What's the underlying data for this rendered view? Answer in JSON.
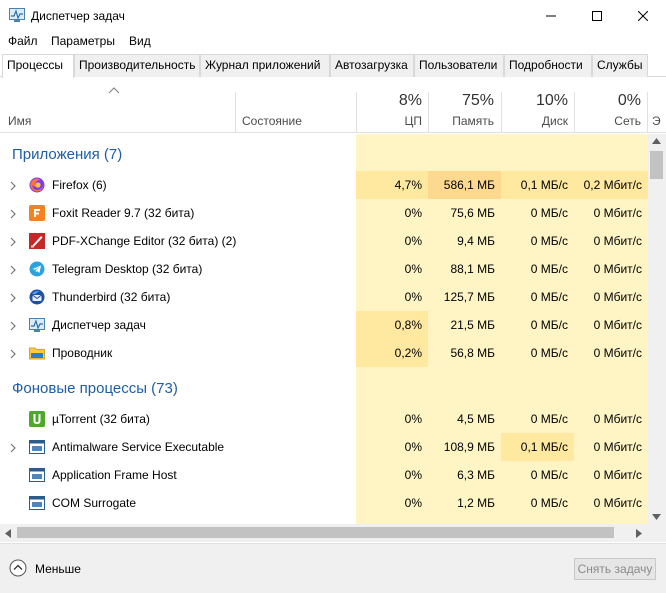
{
  "window": {
    "title": "Диспетчер задач"
  },
  "menu": [
    {
      "label": "Файл"
    },
    {
      "label": "Параметры"
    },
    {
      "label": "Вид"
    }
  ],
  "tabs": [
    {
      "label": "Процессы",
      "active": true
    },
    {
      "label": "Производительность"
    },
    {
      "label": "Журнал приложений"
    },
    {
      "label": "Автозагрузка"
    },
    {
      "label": "Пользователи"
    },
    {
      "label": "Подробности"
    },
    {
      "label": "Службы"
    }
  ],
  "columns": {
    "name": "Имя",
    "status": "Состояние",
    "cpu": {
      "pct": "8%",
      "label": "ЦП"
    },
    "memory": {
      "pct": "75%",
      "label": "Память"
    },
    "disk": {
      "pct": "10%",
      "label": "Диск"
    },
    "network": {
      "pct": "0%",
      "label": "Сеть"
    },
    "overflow": "Э"
  },
  "groups": {
    "apps": "Приложения (7)",
    "background": "Фоновые процессы (73)"
  },
  "apps": [
    {
      "name": "Firefox (6)",
      "icon": "firefox-icon",
      "expand": true,
      "cpu": "4,7%",
      "mem": "586,1 МБ",
      "disk": "0,1 МБ/с",
      "net": "0,2 Мбит/с"
    },
    {
      "name": "Foxit Reader 9.7 (32 бита)",
      "icon": "foxit-icon",
      "expand": true,
      "cpu": "0%",
      "mem": "75,6 МБ",
      "disk": "0 МБ/с",
      "net": "0 Мбит/с"
    },
    {
      "name": "PDF-XChange Editor (32 бита) (2)",
      "icon": "pdf-xchange-icon",
      "expand": true,
      "cpu": "0%",
      "mem": "9,4 МБ",
      "disk": "0 МБ/с",
      "net": "0 Мбит/с"
    },
    {
      "name": "Telegram Desktop (32 бита)",
      "icon": "telegram-icon",
      "expand": true,
      "cpu": "0%",
      "mem": "88,1 МБ",
      "disk": "0 МБ/с",
      "net": "0 Мбит/с"
    },
    {
      "name": "Thunderbird (32 бита)",
      "icon": "thunderbird-icon",
      "expand": true,
      "cpu": "0%",
      "mem": "125,7 МБ",
      "disk": "0 МБ/с",
      "net": "0 Мбит/с"
    },
    {
      "name": "Диспетчер задач",
      "icon": "task-manager-icon",
      "expand": true,
      "cpu": "0,8%",
      "mem": "21,5 МБ",
      "disk": "0 МБ/с",
      "net": "0 Мбит/с"
    },
    {
      "name": "Проводник",
      "icon": "explorer-icon",
      "expand": true,
      "cpu": "0,2%",
      "mem": "56,8 МБ",
      "disk": "0 МБ/с",
      "net": "0 Мбит/с"
    }
  ],
  "background": [
    {
      "name": "µTorrent (32 бита)",
      "icon": "utorrent-icon",
      "expand": false,
      "cpu": "0%",
      "mem": "4,5 МБ",
      "disk": "0 МБ/с",
      "net": "0 Мбит/с"
    },
    {
      "name": "Antimalware Service Executable",
      "icon": "service-icon",
      "expand": true,
      "cpu": "0%",
      "mem": "108,9 МБ",
      "disk": "0,1 МБ/с",
      "net": "0 Мбит/с"
    },
    {
      "name": "Application Frame Host",
      "icon": "service-icon",
      "expand": false,
      "cpu": "0%",
      "mem": "6,3 МБ",
      "disk": "0 МБ/с",
      "net": "0 Мбит/с"
    },
    {
      "name": "COM Surrogate",
      "icon": "service-icon",
      "expand": false,
      "cpu": "0%",
      "mem": "1,2 МБ",
      "disk": "0 МБ/с",
      "net": "0 Мбит/с"
    }
  ],
  "footer": {
    "fewer": "Меньше",
    "end_task": "Снять задачу"
  },
  "colors": {
    "heat_light": "#fff4c4",
    "heat_mid": "#ffe8a0",
    "heat_strong": "#fcd98e",
    "accent": "#1e5ea8"
  }
}
